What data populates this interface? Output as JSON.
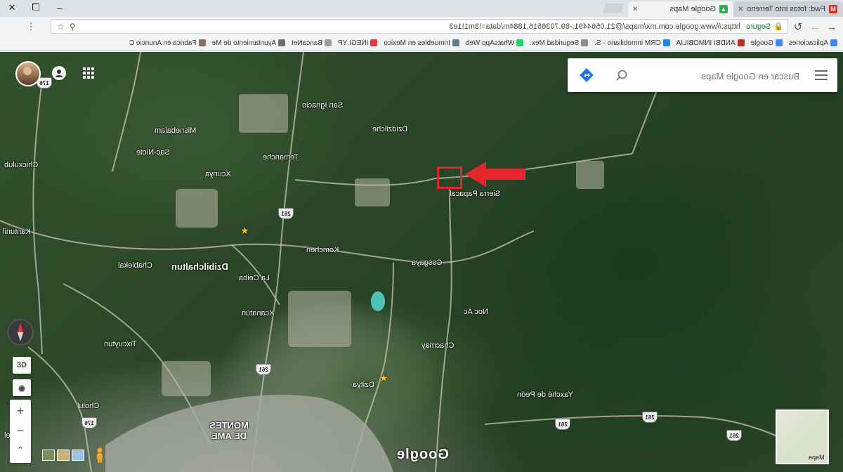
{
  "browser": {
    "tabs": [
      {
        "label": "Fwd: fotos into Terreno",
        "icon": "gmail-icon",
        "active": false
      },
      {
        "label": "Google Maps",
        "icon": "google-maps-icon",
        "active": true
      }
    ],
    "window_controls": {
      "minimize": "–",
      "maximize": "❐",
      "close": "✕"
    },
    "address_bar": {
      "secure_label": "Seguro",
      "url": "https://www.google.com.mx/maps/@21.0564491,-89.7036516,1884m/data=!3m1!1e3"
    },
    "bookmarks": [
      {
        "label": "Aplicaciones",
        "color": "#4285f4"
      },
      {
        "label": "Google",
        "color": "#4285f4"
      },
      {
        "label": "ANDBI INMOBILIA",
        "color": "#c62828"
      },
      {
        "label": "CRM inmobiliario - S.",
        "color": "#1e88e5"
      },
      {
        "label": "Seguridad Mex.",
        "color": "#8e8e8e"
      },
      {
        "label": "WhatsApp Web",
        "color": "#25d366"
      },
      {
        "label": "Inmuebles en Mexico",
        "color": "#607d8b"
      },
      {
        "label": "INEGI.YP",
        "color": "#e53935"
      },
      {
        "label": "BancaNet",
        "color": "#9e9e9e"
      },
      {
        "label": "Ayuntamiento de Me",
        "color": "#6d6d6d"
      },
      {
        "label": "Fabrica en Anuncio C",
        "color": "#8d6e63"
      }
    ]
  },
  "map": {
    "search": {
      "placeholder": "Buscar en Google Maps"
    },
    "labels": [
      {
        "text": "San Ignacio"
      },
      {
        "text": "Dzidzilche"
      },
      {
        "text": "Misnebalam"
      },
      {
        "text": "Sac-Nicte"
      },
      {
        "text": "Temanche"
      },
      {
        "text": "Xcunya"
      },
      {
        "text": "Chicxulub"
      },
      {
        "text": "Sierra Papacal"
      },
      {
        "text": "Komchen"
      },
      {
        "text": "Cosgaya"
      },
      {
        "text": "Chablekal"
      },
      {
        "text": "Dzibilchaltun"
      },
      {
        "text": "La Ceiba"
      },
      {
        "text": "Xcanatún"
      },
      {
        "text": "Noc Ac"
      },
      {
        "text": "Chacmay"
      },
      {
        "text": "Tixcuytun"
      },
      {
        "text": "Dzitya"
      },
      {
        "text": "Yaxché de Peón"
      },
      {
        "text": "Cholul"
      },
      {
        "text": "Kantunil"
      },
      {
        "text": "Caucel"
      }
    ],
    "city_label": "MONTES DE AME",
    "road_shields": [
      "261",
      "261",
      "261",
      "261",
      "176",
      "176",
      "261"
    ],
    "brand": "Google",
    "controls": {
      "view_3d": "3D",
      "zoom_in": "+",
      "zoom_out": "−"
    },
    "minimap_label": "Mapa"
  }
}
